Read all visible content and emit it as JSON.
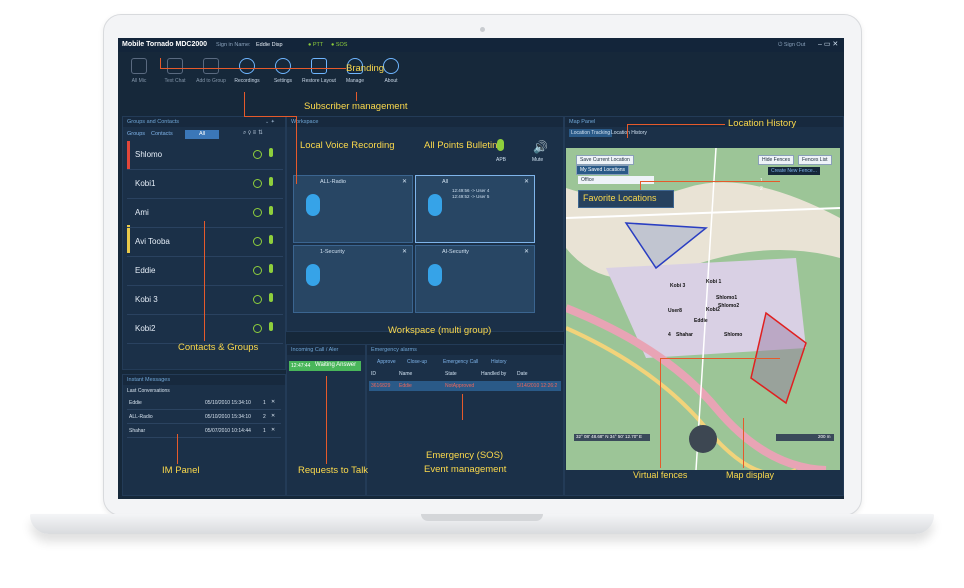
{
  "app": {
    "title": "Mobile Tornado MDC2000",
    "signin_label": "Sign in Name:",
    "user": "Eddie Disp",
    "ptt": "PTT",
    "sos": "SOS",
    "sign_out": "Sign Out"
  },
  "toolbar": [
    {
      "label": "All Mic"
    },
    {
      "label": "Text Chat"
    },
    {
      "label": "Add to Group"
    },
    {
      "label": "Recordings"
    },
    {
      "label": "Settings"
    },
    {
      "label": "Restore Layout"
    },
    {
      "label": "Manage"
    },
    {
      "label": "About"
    }
  ],
  "groups_panel": {
    "title": "Groups and Contacts",
    "tabs": [
      "Groups",
      "Contacts",
      "All"
    ],
    "contacts": [
      "Shlomo",
      "Kobi1",
      "Ami",
      "Avi Tooba",
      "Eddie",
      "Kobi 3",
      "Kobi2"
    ]
  },
  "workspace": {
    "title": "Workspace",
    "mute": "Mute",
    "aps": "APB",
    "tiles": [
      {
        "name": "ALL-Radio",
        "log": []
      },
      {
        "name": "All",
        "log": [
          "12:49:56 -> User 4",
          "12:49:52 -> User 5"
        ]
      },
      {
        "name": "1-Security",
        "log": []
      },
      {
        "name": "AI-Security",
        "log": []
      }
    ]
  },
  "im_panel": {
    "title": "Instant Messages",
    "subtitle": "Last Conversations",
    "rows": [
      {
        "name": "Eddie",
        "date": "05/10/2010 15:34:10",
        "count": "1"
      },
      {
        "name": "ALL-Radio",
        "date": "05/10/2010 15:34:10",
        "count": "2"
      },
      {
        "name": "Shahar",
        "date": "05/07/2010 10:14:44",
        "count": "1"
      }
    ]
  },
  "incoming": {
    "title": "Incoming Call / Aler",
    "time": "12:47:44",
    "status": "Waiting Answer"
  },
  "emergency": {
    "title": "Emergency alarms",
    "buttons": [
      "Approve",
      "Close-up",
      "Emergency Call",
      "History"
    ],
    "headers": [
      "ID",
      "Name",
      "State",
      "Handled by",
      "Date"
    ],
    "row": {
      "id": "3616829",
      "name": "Eddie",
      "state": "NotApproved",
      "handled": "",
      "date": "5/14/2010 12:26:2"
    }
  },
  "map_panel": {
    "title": "Map Panel",
    "tabs": [
      "Location Tracking",
      "Location History"
    ],
    "save_location": "Save Current Location",
    "my_locations": "My Saved Locations",
    "office": "Office",
    "hide_fences": "Hide Fences",
    "fences_list": "Fences List",
    "create_fence": "Create New Fence...",
    "fence_items": [
      "1",
      "2"
    ],
    "coords": "32° 08' 48.68\" N 34° 50' 12.70\" E",
    "scale": "200 m",
    "markers": [
      "Kobi 1",
      "Kobi 3",
      "Shlomo1",
      "Shlomo2",
      "Shahar",
      "Kobi2",
      "Shlomo",
      "User8",
      "4",
      "Eddie"
    ]
  },
  "annotations": {
    "branding": "Branding",
    "subscriber": "Subscriber management",
    "local_voice": "Local Voice Recording",
    "apb": "All Points Bulletin",
    "location_history": "Location History",
    "favorite": "Favorite Locations",
    "workspace_multi": "Workspace (multi group)",
    "contacts_groups": "Contacts & Groups",
    "im_panel": "IM Panel",
    "requests": "Requests to Talk",
    "emergency": "Emergency (SOS)",
    "event": "Event management",
    "virtual_fences": "Virtual fences",
    "map_display": "Map display"
  }
}
